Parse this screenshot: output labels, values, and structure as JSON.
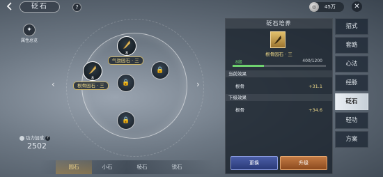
{
  "header": {
    "title": "砭石",
    "help": "?",
    "currency_amount": "45万",
    "close": "✕"
  },
  "left": {
    "attr_overview_label": "属性总览",
    "combat_label": "功力加成",
    "combat_value": "2502",
    "combat_help": "?"
  },
  "wheel": {
    "gem_top_level": "8",
    "gem_top_label": "气劲园石 · 三",
    "gem_left_level": "8",
    "gem_left_label": "根骨园石 · 三",
    "arrow_left": "‹",
    "arrow_right": "›"
  },
  "stone_tabs": [
    "园石",
    "小石",
    "棱石",
    "锐石"
  ],
  "panel": {
    "title": "砭石培养",
    "gem_name": "根骨园石 · 三",
    "level_text": "8级",
    "exp_text": "400/1200",
    "exp_fraction": 0.333,
    "current_effect_header": "当前效果",
    "current_stat": "根骨",
    "current_value": "+31.1",
    "next_effect_header": "下级效果",
    "next_stat": "根骨",
    "next_value": "+34.6",
    "replace_label": "更换",
    "upgrade_label": "升级"
  },
  "side_tabs": [
    "招式",
    "套路",
    "心法",
    "经脉",
    "砭石",
    "轻功",
    "方案"
  ],
  "colors": {
    "accent_gold": "#f2dc8a",
    "exp_green": "#6fd26f",
    "replace_blue": "#4b5ea7",
    "upgrade_orange": "#c27a44"
  }
}
